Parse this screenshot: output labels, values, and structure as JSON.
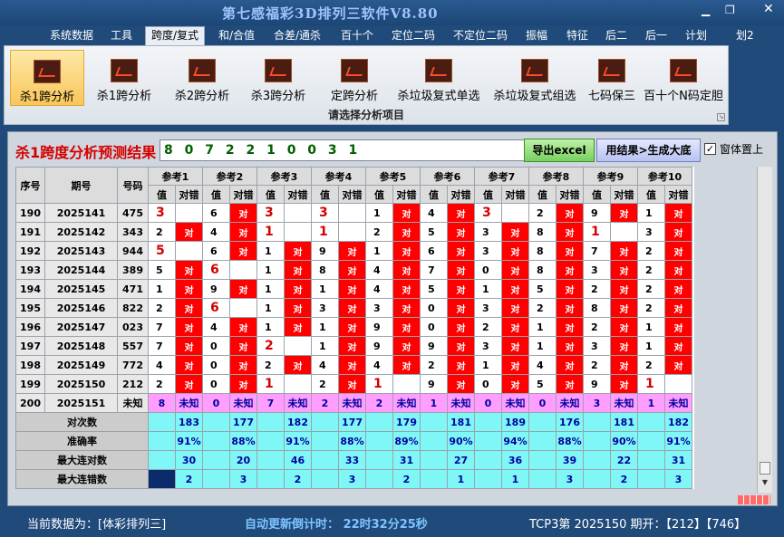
{
  "app": {
    "title": "第七感福彩3D排列三软件V8.80"
  },
  "menu": [
    "系统数据",
    "工具",
    "跨度/复式",
    "和/合值",
    "合差/通杀",
    "百十个",
    "定位二码",
    "不定位二码",
    "振幅",
    "特征",
    "后二",
    "后一",
    "计划",
    "划2"
  ],
  "ribbon": {
    "buttons": [
      "杀1跨分析",
      "杀1跨分析",
      "杀2跨分析",
      "杀3跨分析",
      "定跨分析",
      "杀垃圾复式单选",
      "杀垃圾复式组选",
      "七码保三",
      "百十个N码定胆"
    ],
    "caption": "请选择分析项目"
  },
  "result": {
    "title": "杀1跨度分析预测结果",
    "value": "8 0 7 2 2 1 0 0 3 1"
  },
  "buttons": {
    "excel": "导出excel",
    "generate": "用结果>生成大底",
    "pin": "窗体置上",
    "pin_check": "✓"
  },
  "table": {
    "col_seq": "序号",
    "col_period": "期号",
    "col_num": "号码",
    "refs": [
      "参考1",
      "参考2",
      "参考3",
      "参考4",
      "参考5",
      "参考6",
      "参考7",
      "参考8",
      "参考9",
      "参考10"
    ],
    "sub_val": "值",
    "sub_hit": "对错",
    "hit_text": "对",
    "unknown": "未知",
    "rows": [
      {
        "seq": "190",
        "period": "2025141",
        "num": "475",
        "vals": [
          "3",
          "6",
          "3",
          "3",
          "1",
          "4",
          "3",
          "2",
          "9",
          "1"
        ],
        "hits": [
          false,
          true,
          false,
          false,
          true,
          true,
          false,
          true,
          true,
          true
        ],
        "red": [
          true,
          false,
          true,
          true,
          false,
          false,
          true,
          false,
          false,
          false
        ]
      },
      {
        "seq": "191",
        "period": "2025142",
        "num": "343",
        "vals": [
          "2",
          "4",
          "1",
          "1",
          "2",
          "5",
          "3",
          "8",
          "1",
          "3"
        ],
        "hits": [
          true,
          true,
          false,
          false,
          true,
          true,
          true,
          true,
          false,
          true
        ],
        "red": [
          false,
          false,
          true,
          true,
          false,
          false,
          false,
          false,
          true,
          false
        ]
      },
      {
        "seq": "192",
        "period": "2025143",
        "num": "944",
        "vals": [
          "5",
          "6",
          "1",
          "9",
          "1",
          "6",
          "3",
          "8",
          "7",
          "2"
        ],
        "hits": [
          false,
          true,
          true,
          true,
          true,
          true,
          true,
          true,
          true,
          true
        ],
        "red": [
          true,
          false,
          false,
          false,
          false,
          false,
          false,
          false,
          false,
          false
        ]
      },
      {
        "seq": "193",
        "period": "2025144",
        "num": "389",
        "vals": [
          "5",
          "6",
          "1",
          "8",
          "4",
          "7",
          "0",
          "8",
          "3",
          "2"
        ],
        "hits": [
          true,
          false,
          true,
          true,
          true,
          true,
          true,
          true,
          true,
          true
        ],
        "red": [
          false,
          true,
          false,
          false,
          false,
          false,
          false,
          false,
          false,
          false
        ]
      },
      {
        "seq": "194",
        "period": "2025145",
        "num": "471",
        "vals": [
          "1",
          "9",
          "1",
          "1",
          "4",
          "5",
          "1",
          "5",
          "2",
          "2"
        ],
        "hits": [
          true,
          true,
          true,
          true,
          true,
          true,
          true,
          true,
          true,
          true
        ],
        "red": [
          false,
          false,
          false,
          false,
          false,
          false,
          false,
          false,
          false,
          false
        ]
      },
      {
        "seq": "195",
        "period": "2025146",
        "num": "822",
        "vals": [
          "2",
          "6",
          "1",
          "3",
          "3",
          "0",
          "3",
          "2",
          "8",
          "2"
        ],
        "hits": [
          true,
          false,
          true,
          true,
          true,
          true,
          true,
          true,
          true,
          true
        ],
        "red": [
          false,
          true,
          false,
          false,
          false,
          false,
          false,
          false,
          false,
          false
        ]
      },
      {
        "seq": "196",
        "period": "2025147",
        "num": "023",
        "vals": [
          "7",
          "4",
          "1",
          "1",
          "9",
          "0",
          "2",
          "1",
          "2",
          "1"
        ],
        "hits": [
          true,
          true,
          true,
          true,
          true,
          true,
          true,
          true,
          true,
          true
        ],
        "red": [
          false,
          false,
          false,
          false,
          false,
          false,
          false,
          false,
          false,
          false
        ]
      },
      {
        "seq": "197",
        "period": "2025148",
        "num": "557",
        "vals": [
          "7",
          "0",
          "2",
          "1",
          "9",
          "9",
          "3",
          "1",
          "3",
          "1"
        ],
        "hits": [
          true,
          true,
          false,
          true,
          true,
          true,
          true,
          true,
          true,
          true
        ],
        "red": [
          false,
          false,
          true,
          false,
          false,
          false,
          false,
          false,
          false,
          false
        ]
      },
      {
        "seq": "198",
        "period": "2025149",
        "num": "772",
        "vals": [
          "4",
          "0",
          "2",
          "4",
          "4",
          "2",
          "1",
          "4",
          "2",
          "2"
        ],
        "hits": [
          true,
          true,
          true,
          true,
          true,
          true,
          true,
          true,
          true,
          true
        ],
        "red": [
          false,
          false,
          false,
          false,
          false,
          false,
          false,
          false,
          false,
          false
        ]
      },
      {
        "seq": "199",
        "period": "2025150",
        "num": "212",
        "vals": [
          "2",
          "0",
          "1",
          "2",
          "1",
          "9",
          "0",
          "5",
          "9",
          "1"
        ],
        "hits": [
          true,
          true,
          false,
          true,
          false,
          true,
          true,
          true,
          true,
          false
        ],
        "red": [
          false,
          false,
          true,
          false,
          true,
          false,
          false,
          false,
          false,
          true
        ]
      }
    ],
    "pending": {
      "seq": "200",
      "period": "2025151",
      "num": "未知",
      "vals": [
        "8",
        "0",
        "7",
        "2",
        "2",
        "1",
        "0",
        "0",
        "3",
        "1"
      ]
    },
    "stats": [
      {
        "label": "对次数",
        "vals": [
          "183",
          "177",
          "182",
          "177",
          "179",
          "181",
          "189",
          "176",
          "181",
          "182"
        ]
      },
      {
        "label": "准确率",
        "vals": [
          "91%",
          "88%",
          "91%",
          "88%",
          "89%",
          "90%",
          "94%",
          "88%",
          "90%",
          "91%"
        ]
      },
      {
        "label": "最大连对数",
        "vals": [
          "30",
          "20",
          "46",
          "33",
          "31",
          "27",
          "36",
          "39",
          "22",
          "31"
        ]
      },
      {
        "label": "最大连错数",
        "vals": [
          "2",
          "3",
          "2",
          "3",
          "2",
          "1",
          "1",
          "3",
          "2",
          "3"
        ]
      }
    ]
  },
  "status": {
    "current": "当前数据为：[体彩排列三]",
    "countdown": "自动更新倒计时：  22时32分25秒",
    "period": "TCP3第  2025150  期开：【212】【746】"
  }
}
